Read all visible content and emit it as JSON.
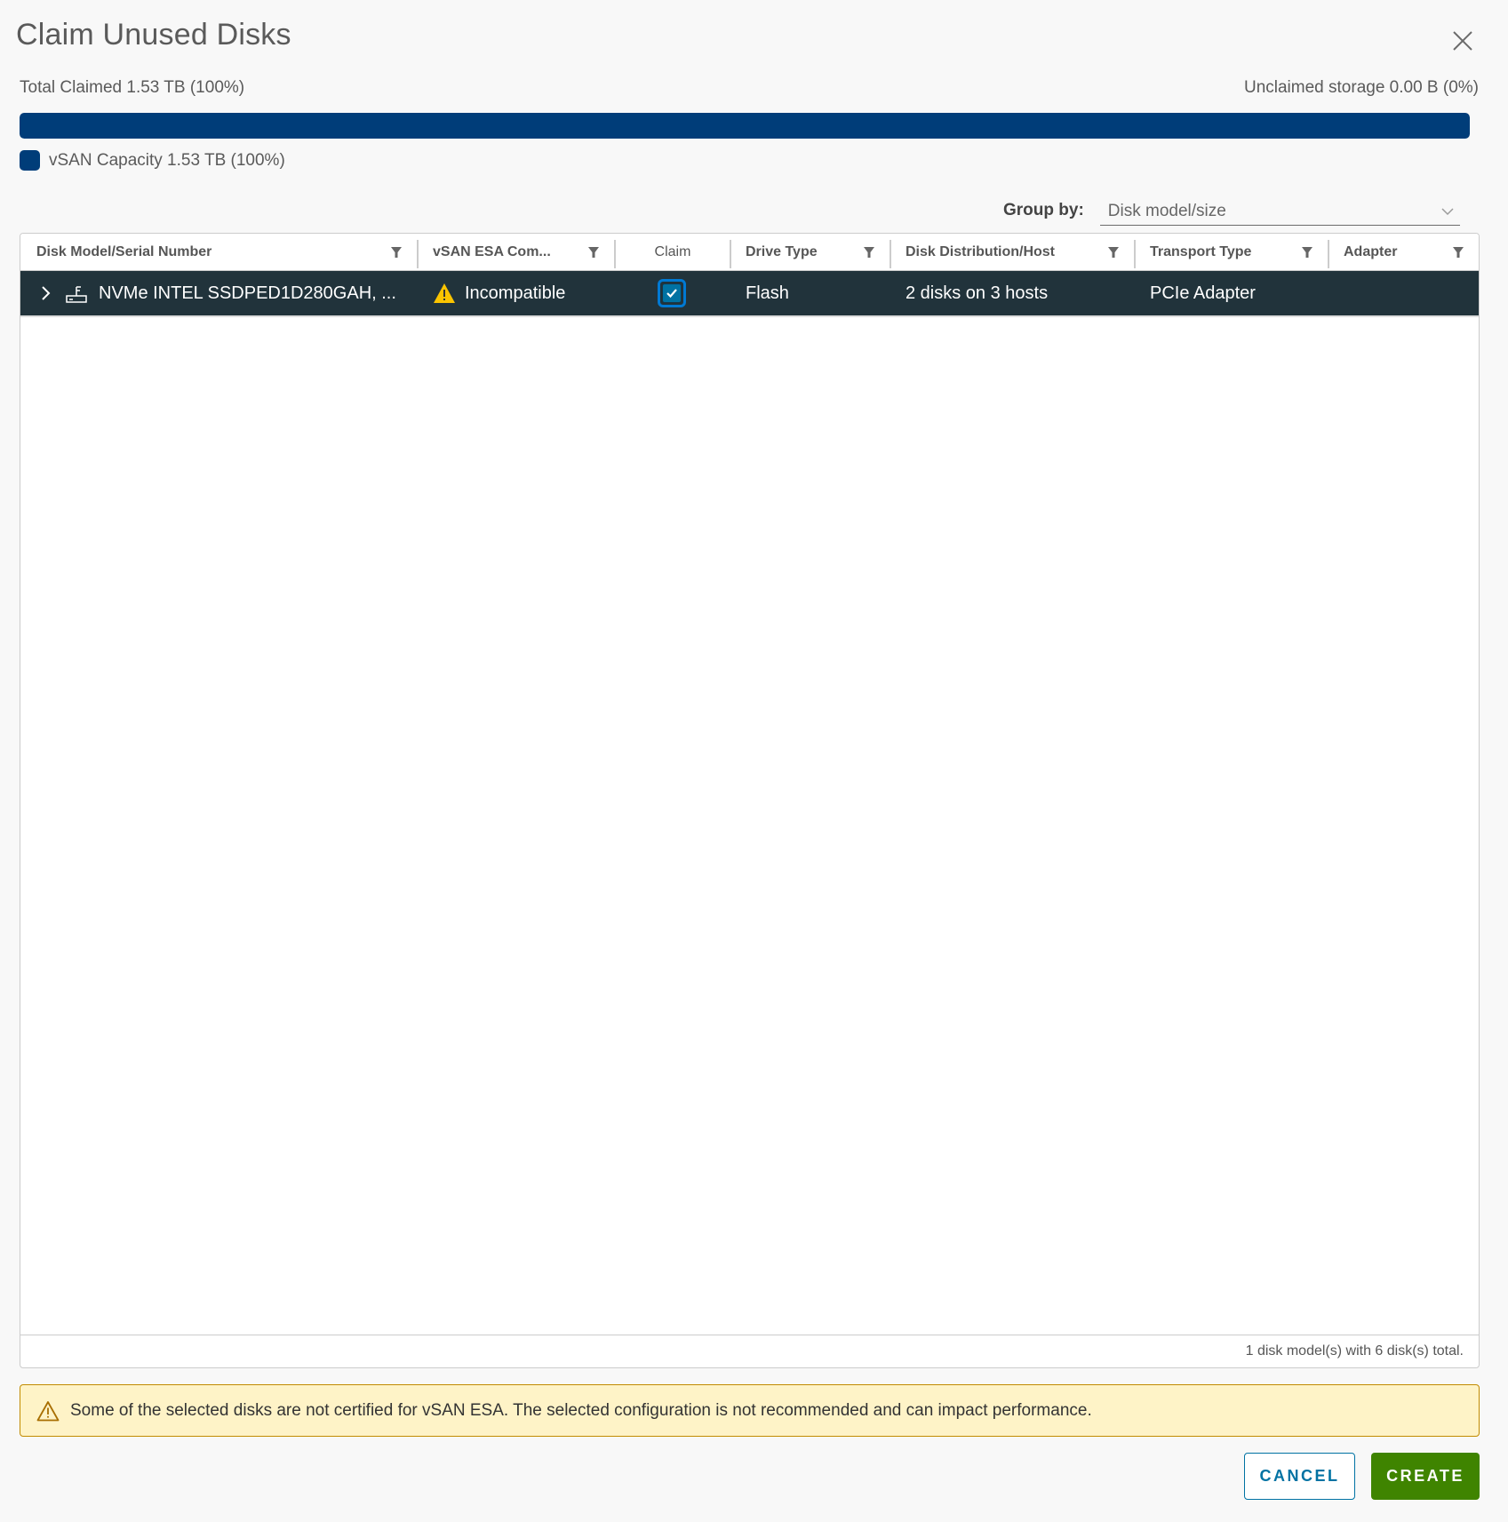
{
  "dialog": {
    "title": "Claim Unused Disks",
    "close_icon": "close-icon"
  },
  "capacity": {
    "total_claimed_label": "Total Claimed 1.53 TB (100%)",
    "unclaimed_label": "Unclaimed storage 0.00 B (0%)",
    "claimed_fraction": 1.0,
    "bar_color": "#003d79",
    "legend": [
      {
        "label": "vSAN Capacity 1.53 TB (100%)",
        "color": "#003d79"
      }
    ]
  },
  "group_by": {
    "label": "Group by:",
    "value": "Disk model/size"
  },
  "grid": {
    "columns": [
      {
        "label": "Disk Model/Serial Number",
        "filterable": true
      },
      {
        "label": "vSAN ESA Com...",
        "filterable": true
      },
      {
        "label": "Claim",
        "filterable": false
      },
      {
        "label": "Drive Type",
        "filterable": true
      },
      {
        "label": "Disk Distribution/Host",
        "filterable": true
      },
      {
        "label": "Transport Type",
        "filterable": true
      },
      {
        "label": "Adapter",
        "filterable": true
      }
    ],
    "rows": [
      {
        "disk_model": "NVMe INTEL SSDPED1D280GAH, ...",
        "disk_icon": "flash-disk-icon",
        "compatibility": "Incompatible",
        "compatibility_icon": "warning-icon",
        "claim_checked": true,
        "drive_type": "Flash",
        "distribution": "2 disks on 3 hosts",
        "transport_type": "PCIe Adapter",
        "adapter": ""
      }
    ],
    "footer": "1 disk model(s) with 6 disk(s) total."
  },
  "alert": {
    "type": "warning",
    "message": "Some of the selected disks are not certified for vSAN ESA. The selected configuration is not recommended and can impact performance."
  },
  "buttons": {
    "cancel": "CANCEL",
    "create": "CREATE"
  },
  "colors": {
    "primary": "#0072a3",
    "success": "#3f8400",
    "row_selected": "#21333b",
    "warning_bg": "#fef3c7",
    "warning_border": "#c28b00"
  }
}
